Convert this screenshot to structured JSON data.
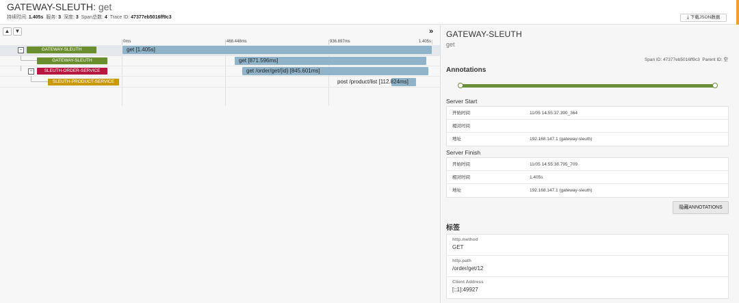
{
  "header": {
    "service": "GATEWAY-SLEUTH",
    "separator": ":",
    "operation": "get",
    "duration_label": "持续时间:",
    "duration_value": "1.405s",
    "services_label": "服务:",
    "services_value": "3",
    "depth_label": "深度:",
    "depth_value": "3",
    "spans_label": "Span总数:",
    "spans_value": "4",
    "trace_label": "Trace ID:",
    "trace_value": "47377eb5016ff9c3",
    "download_label": "下载JSON数据",
    "download_icon": "download-icon"
  },
  "left": {
    "expand_icon": "chevron-up-icon",
    "collapse_all_icon": "chevron-down-icon",
    "collapse_panel_icon": "double-chevron-right-icon",
    "ticks": [
      "0ms",
      "468.448ms",
      "936.897ms",
      "1.405s"
    ],
    "spans": [
      {
        "service": "GATEWAY-SLEUTH",
        "label": "get [1.405s]",
        "color": "#6a8e2e",
        "toggle": "−"
      },
      {
        "service": "GATEWAY-SLEUTH",
        "label": "get [871.596ms]",
        "color": "#6a8e2e",
        "toggle": ""
      },
      {
        "service": "SLEUTH-ORDER-SERVICE",
        "label": "get /order/get/{id} [845.601ms]",
        "color": "#b5173f",
        "toggle": "−"
      },
      {
        "service": "SLEUTH-PRODUCT-SERVICE",
        "label": "post /product/list [112.824ms]",
        "color": "#c99a0e",
        "toggle": ""
      }
    ]
  },
  "right": {
    "service": "GATEWAY-SLEUTH",
    "operation": "get",
    "span_id_label": "Span ID:",
    "span_id": "47377eb5016ff9c3",
    "parent_id_label": "Parent ID:",
    "parent_id": "空",
    "annotations_title": "Annotations",
    "timeline_color": "#6b8e3a",
    "server_start": {
      "title": "Server Start",
      "rows": [
        {
          "k": "开始时间",
          "v": "11/05 14:55:37.390_364"
        },
        {
          "k": "相对时间",
          "v": ""
        },
        {
          "k": "地址",
          "v": "192.168.147.1 (gateway-sleuth)"
        }
      ]
    },
    "server_finish": {
      "title": "Server Finish",
      "rows": [
        {
          "k": "开始时间",
          "v": "11/05 14:55:38.795_709"
        },
        {
          "k": "相对时间",
          "v": "1.405s"
        },
        {
          "k": "地址",
          "v": "192.168.147.1 (gateway-sleuth)"
        }
      ]
    },
    "hide_button": "隐藏ANNOTATIONS",
    "tags_title": "标签",
    "tags": [
      {
        "k": "http.method",
        "v": "GET"
      },
      {
        "k": "http.path",
        "v": "/order/get/12"
      },
      {
        "k": "Client Address",
        "v": "[::1]:49927"
      }
    ]
  }
}
